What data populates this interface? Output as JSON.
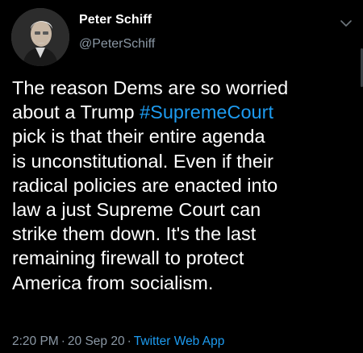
{
  "author": {
    "display_name": "Peter Schiff",
    "handle": "@PeterSchiff"
  },
  "tweet": {
    "lines": [
      {
        "text": "The reason Dems are so worried"
      },
      {
        "pre": "about a Trump ",
        "hashtag": "#SupremeCourt"
      },
      {
        "text": "pick is that their entire agenda"
      },
      {
        "text": "is unconstitutional. Even if their"
      },
      {
        "text": "radical policies are enacted into"
      },
      {
        "text": "law a just Supreme Court can"
      },
      {
        "text": "strike them down. It's the last"
      },
      {
        "text": "remaining firewall to protect"
      },
      {
        "text": "America from socialism."
      }
    ]
  },
  "meta": {
    "time": "2:20 PM",
    "date": "20 Sep 20",
    "separator": "·",
    "source": "Twitter Web App"
  },
  "icons": {
    "menu": "chevron-down-icon",
    "avatar": "profile-photo"
  },
  "colors": {
    "background": "#000000",
    "text": "#ffffff",
    "secondary": "#8b98a5",
    "accent": "#1d9bf0"
  }
}
